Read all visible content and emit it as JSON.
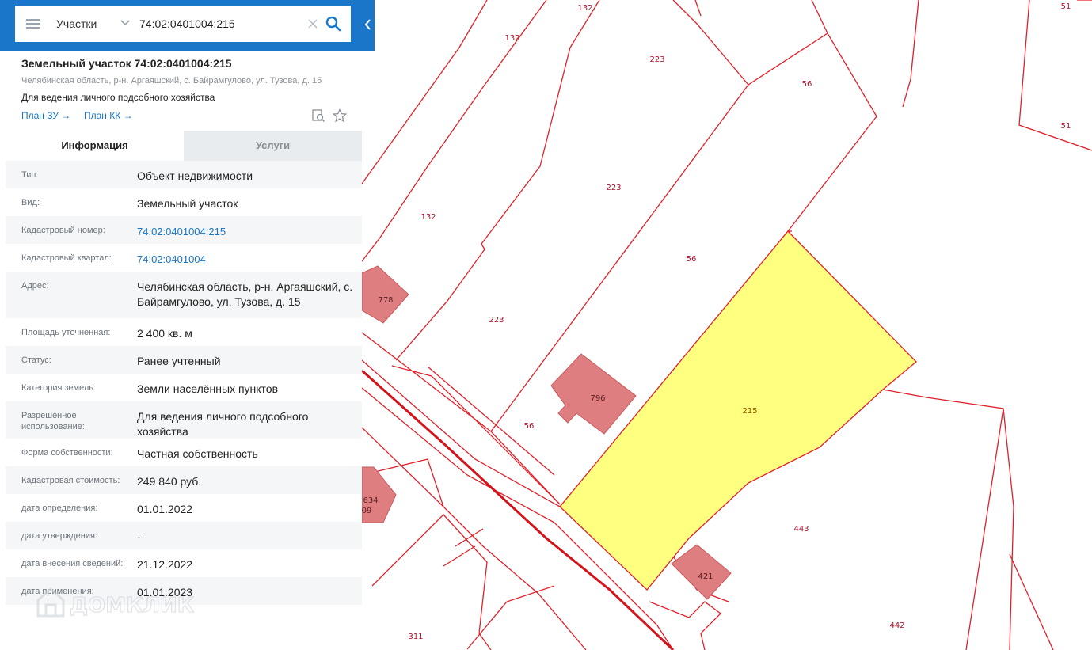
{
  "search": {
    "layer": "Участки",
    "query": "74:02:0401004:215"
  },
  "parcel": {
    "title": "Земельный участок 74:02:0401004:215",
    "address_short": "Челябинская область, р-н. Аргаяшский, с. Байрамгулово, ул. Тузова, д. 15",
    "purpose": "Для ведения личного подсобного хозяйства",
    "plan_zu": "План ЗУ →",
    "plan_kk": "План КК →"
  },
  "tabs": {
    "info": "Информация",
    "services": "Услуги"
  },
  "details": [
    {
      "label": "Тип:",
      "value": "Объект недвижимости"
    },
    {
      "label": "Вид:",
      "value": "Земельный участок"
    },
    {
      "label": "Кадастровый номер:",
      "value": "74:02:0401004:215",
      "link": true
    },
    {
      "label": "Кадастровый квартал:",
      "value": "74:02:0401004",
      "link": true
    },
    {
      "label": "Адрес:",
      "value": "Челябинская область, р-н. Аргаяшский, с. Байрамгулово, ул. Тузова, д. 15"
    },
    {
      "label": "Площадь уточненная:",
      "value": "2 400 кв. м"
    },
    {
      "label": "Статус:",
      "value": "Ранее учтенный"
    },
    {
      "label": "Категория земель:",
      "value": "Земли населённых пунктов"
    },
    {
      "label": "Разрешенное использование:",
      "value": "Для ведения личного подсобного хозяйства"
    },
    {
      "label": "Форма собственности:",
      "value": "Частная собственность"
    },
    {
      "label": "Кадастровая стоимость:",
      "value": "249 840 руб."
    },
    {
      "label": "дата определения:",
      "value": "01.01.2022"
    },
    {
      "label": "дата утверждения:",
      "value": "-"
    },
    {
      "label": "дата внесения сведений:",
      "value": "21.12.2022"
    },
    {
      "label": "дата применения:",
      "value": "01.01.2023"
    }
  ],
  "watermark": "ДОМКЛИК",
  "map_labels": {
    "l132a": "132",
    "l132b": "132",
    "l132c": "132",
    "l223a": "223",
    "l223b": "223",
    "l223c": "223",
    "l56a": "56",
    "l56b": "56",
    "l56c": "56",
    "l51a": "51",
    "l51b": "51",
    "l778": "778",
    "l796": "796",
    "l634": "634",
    "l09": "09",
    "l215": "215",
    "l443": "443",
    "l421": "421",
    "l311": "311",
    "l442": "442"
  },
  "colors": {
    "accent": "#1976c8",
    "boundary": "#e0202a",
    "selected_fill": "#ffff80",
    "building_fill": "#df7e80"
  }
}
